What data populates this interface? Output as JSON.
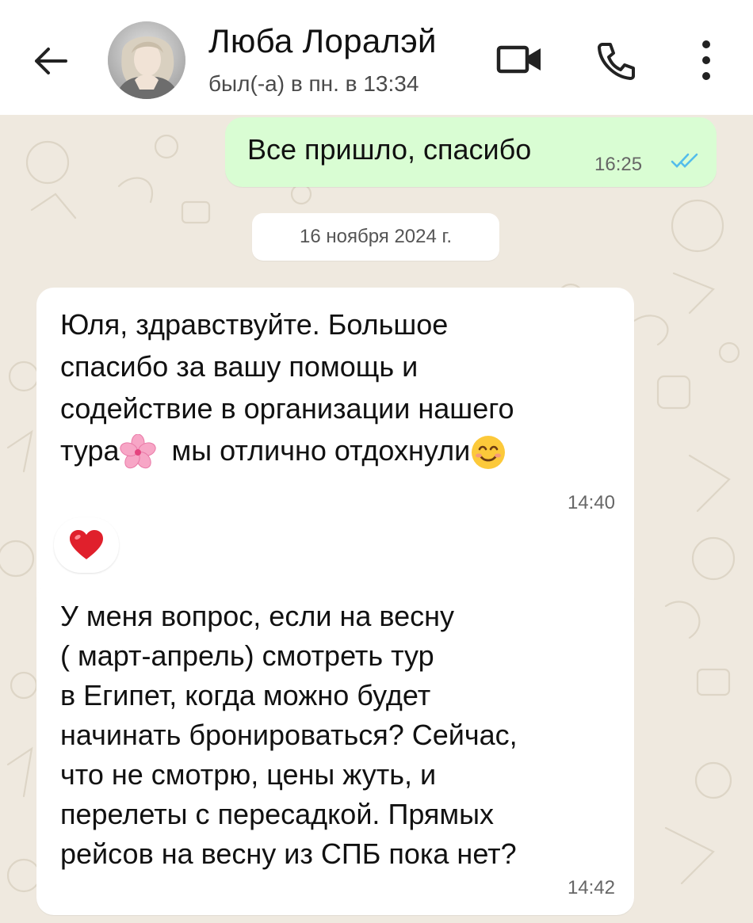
{
  "header": {
    "contact_name": "Люба Лоралэй",
    "status": "был(-а) в пн. в 13:34",
    "icons": [
      "back-arrow-icon",
      "video-camera-icon",
      "phone-icon",
      "more-vertical-icon"
    ]
  },
  "messages": [
    {
      "direction": "outgoing",
      "text": "Все пришло, спасибо",
      "time": "16:25",
      "status": "read",
      "tick_color": "#53bdeb"
    },
    {
      "type": "date-separator",
      "text": "16 ноября 2024 г."
    },
    {
      "direction": "incoming",
      "lines": [
        "Юля, здравствуйте. Большое",
        "спасибо за вашу помощь и",
        "содействие в организации нашего",
        "тура",
        "мы отлично отдохнули"
      ],
      "emojis": [
        "cherry-blossom",
        "smiling-face"
      ],
      "time": "14:40",
      "reaction": "red-heart"
    },
    {
      "direction": "incoming",
      "lines": [
        "У меня вопрос, если на весну",
        "( март-апрель) смотреть тур",
        "в Египет, когда можно будет",
        "начинать бронироваться? Сейчас,",
        "что не смотрю, цены жуть, и",
        "перелеты с пересадкой. Прямых",
        "рейсов на весну из СПБ пока нет?"
      ],
      "time": "14:42"
    }
  ],
  "colors": {
    "header_bg": "#ffffff",
    "chat_bg": "#efe9df",
    "outgoing_bubble": "#d9fdd3",
    "incoming_bubble": "#ffffff",
    "read_ticks": "#53bdeb",
    "heart": "#e0202c"
  }
}
